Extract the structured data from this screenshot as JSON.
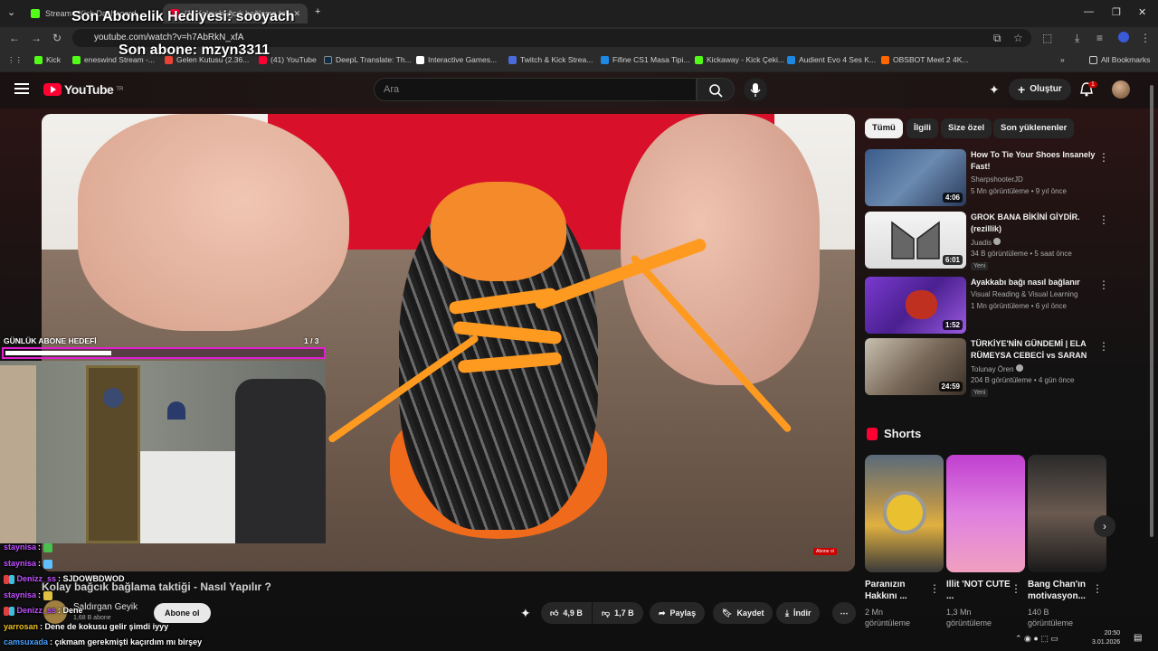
{
  "browser": {
    "tabs": [
      {
        "label": "Stream - Kick Dashboard"
      },
      {
        "label": "(1) Kolay bağcık bağlama taktiği"
      }
    ],
    "url": "youtube.com/watch?v=h7AbRkN_xfA",
    "bookmarks": [
      {
        "label": "Kick",
        "color": "#53fc18"
      },
      {
        "label": "eneswind Stream -...",
        "color": "#53fc18"
      },
      {
        "label": "Gelen Kutusu (2.36...",
        "color": "#ea4335"
      },
      {
        "label": "(41) YouTube",
        "color": "#ff0033"
      },
      {
        "label": "DeepL Translate: Th...",
        "color": "#0f2b46"
      },
      {
        "label": "Interactive Games...",
        "color": "#ffffff"
      },
      {
        "label": "Twitch & Kick Strea...",
        "color": "#4a6bd8"
      },
      {
        "label": "Fifine CS1 Masa Tipi...",
        "color": "#1e88e5"
      },
      {
        "label": "Kickaway - Kick Çeki...",
        "color": "#53fc18"
      },
      {
        "label": "Audient Evo 4 Ses K...",
        "color": "#1e88e5"
      },
      {
        "label": "OBSBOT Meet 2 4K...",
        "color": "#ff6600"
      }
    ],
    "all_bookmarks": "All Bookmarks"
  },
  "overlay": {
    "sub_gift": "Son Abonelik Hediyesi: sooyach",
    "last_sub": "Son abone: mzyn3311",
    "goal_label": "GÜNLÜK ABONE HEDEFİ",
    "goal_count": "1 / 3",
    "goal_progress": 0.333
  },
  "chat": [
    {
      "user": "staynisa",
      "msg": "",
      "color": "#c050ff"
    },
    {
      "user": "staynisa",
      "msg": "",
      "color": "#c050ff"
    },
    {
      "user": "Denizz_ss",
      "msg": "SJDOWBDWOD",
      "color": "#c050ff"
    },
    {
      "user": "staynisa",
      "msg": "",
      "color": "#c050ff"
    },
    {
      "user": "Denizz_ss",
      "msg": "Dene",
      "color": "#c050ff"
    },
    {
      "user": "yarrosan",
      "msg": "Dene de kokusu gelir şimdi iyyy",
      "color": "#f0c020"
    },
    {
      "user": "camsuxada",
      "msg": "çıkmam gerekmişti kaçırdım mı birşey",
      "color": "#4aa0ff"
    }
  ],
  "youtube": {
    "logo": "YouTube",
    "logo_region": "TR",
    "search_placeholder": "Ara",
    "create_label": "Oluştur",
    "notif_count": "1",
    "video_title": "Kolay bağcık bağlama taktiği - Nasıl Yapılır ?",
    "channel_name": "Saldırgan Geyik",
    "channel_subs": "1,68 B abone",
    "subscribe_label": "Abone ol",
    "likes": "4,9 B",
    "dislikes": "1,7 B",
    "share": "Paylaş",
    "save": "Kaydet",
    "download": "İndir",
    "subscribe_watermark": "Abone ol",
    "chips": [
      "Tümü",
      "İlgili",
      "Size özel",
      "Son yüklenenler"
    ],
    "recommended": [
      {
        "title": "How To Tie Your Shoes Insanely Fast!",
        "channel": "SharpshooterJD",
        "meta": "5 Mn görüntüleme • 9 yıl önce",
        "duration": "4:06",
        "verified": false,
        "new": ""
      },
      {
        "title": "GROK BANA BİKİNİ GİYDİR. (rezillik)",
        "channel": "Juadis",
        "meta": "34 B görüntüleme • 5 saat önce",
        "duration": "6:01",
        "verified": true,
        "new": "Yeni"
      },
      {
        "title": "Ayakkabı bağı nasıl bağlanır",
        "channel": "Visual Reading & Visual Learning",
        "meta": "1 Mn görüntüleme • 6 yıl önce",
        "duration": "1:52",
        "verified": false,
        "new": ""
      },
      {
        "title": "TÜRKİYE'NİN GÜNDEMİ | ELA RÜMEYSA CEBECİ vs SARAN",
        "channel": "Tolunay Ören",
        "meta": "204 B görüntüleme • 4 gün önce",
        "duration": "24:59",
        "verified": true,
        "new": "Yeni"
      }
    ],
    "shorts_title": "Shorts",
    "shorts": [
      {
        "title": "Paranızın Hakkını ...",
        "meta": "2 Mn görüntüleme"
      },
      {
        "title": "Illit 'NOT CUTE ...",
        "meta": "1,3 Mn görüntüleme"
      },
      {
        "title": "Bang Chan'ın motivasyon...",
        "meta": "140 B görüntüleme"
      }
    ]
  },
  "system": {
    "time": "20:50",
    "date": "3.01.2026"
  }
}
